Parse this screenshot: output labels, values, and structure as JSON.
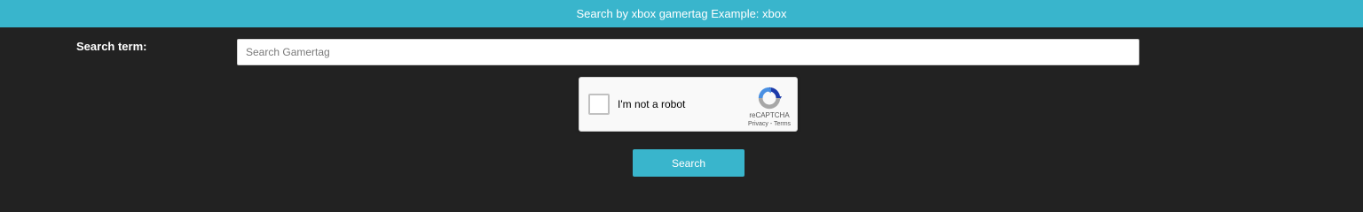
{
  "banner": {
    "text": "Search by xbox gamertag Example: xbox"
  },
  "search": {
    "label": "Search term:",
    "placeholder": "Search Gamertag",
    "value": ""
  },
  "captcha": {
    "checkbox_label": "I'm not a robot",
    "brand": "reCAPTCHA",
    "privacy_link": "Privacy",
    "separator": " - ",
    "terms_link": "Terms",
    "checked": false,
    "logo_icon": "recaptcha-logo-icon"
  },
  "actions": {
    "search_button": "Search"
  },
  "colors": {
    "accent": "#39b5cc",
    "background": "#222222"
  }
}
